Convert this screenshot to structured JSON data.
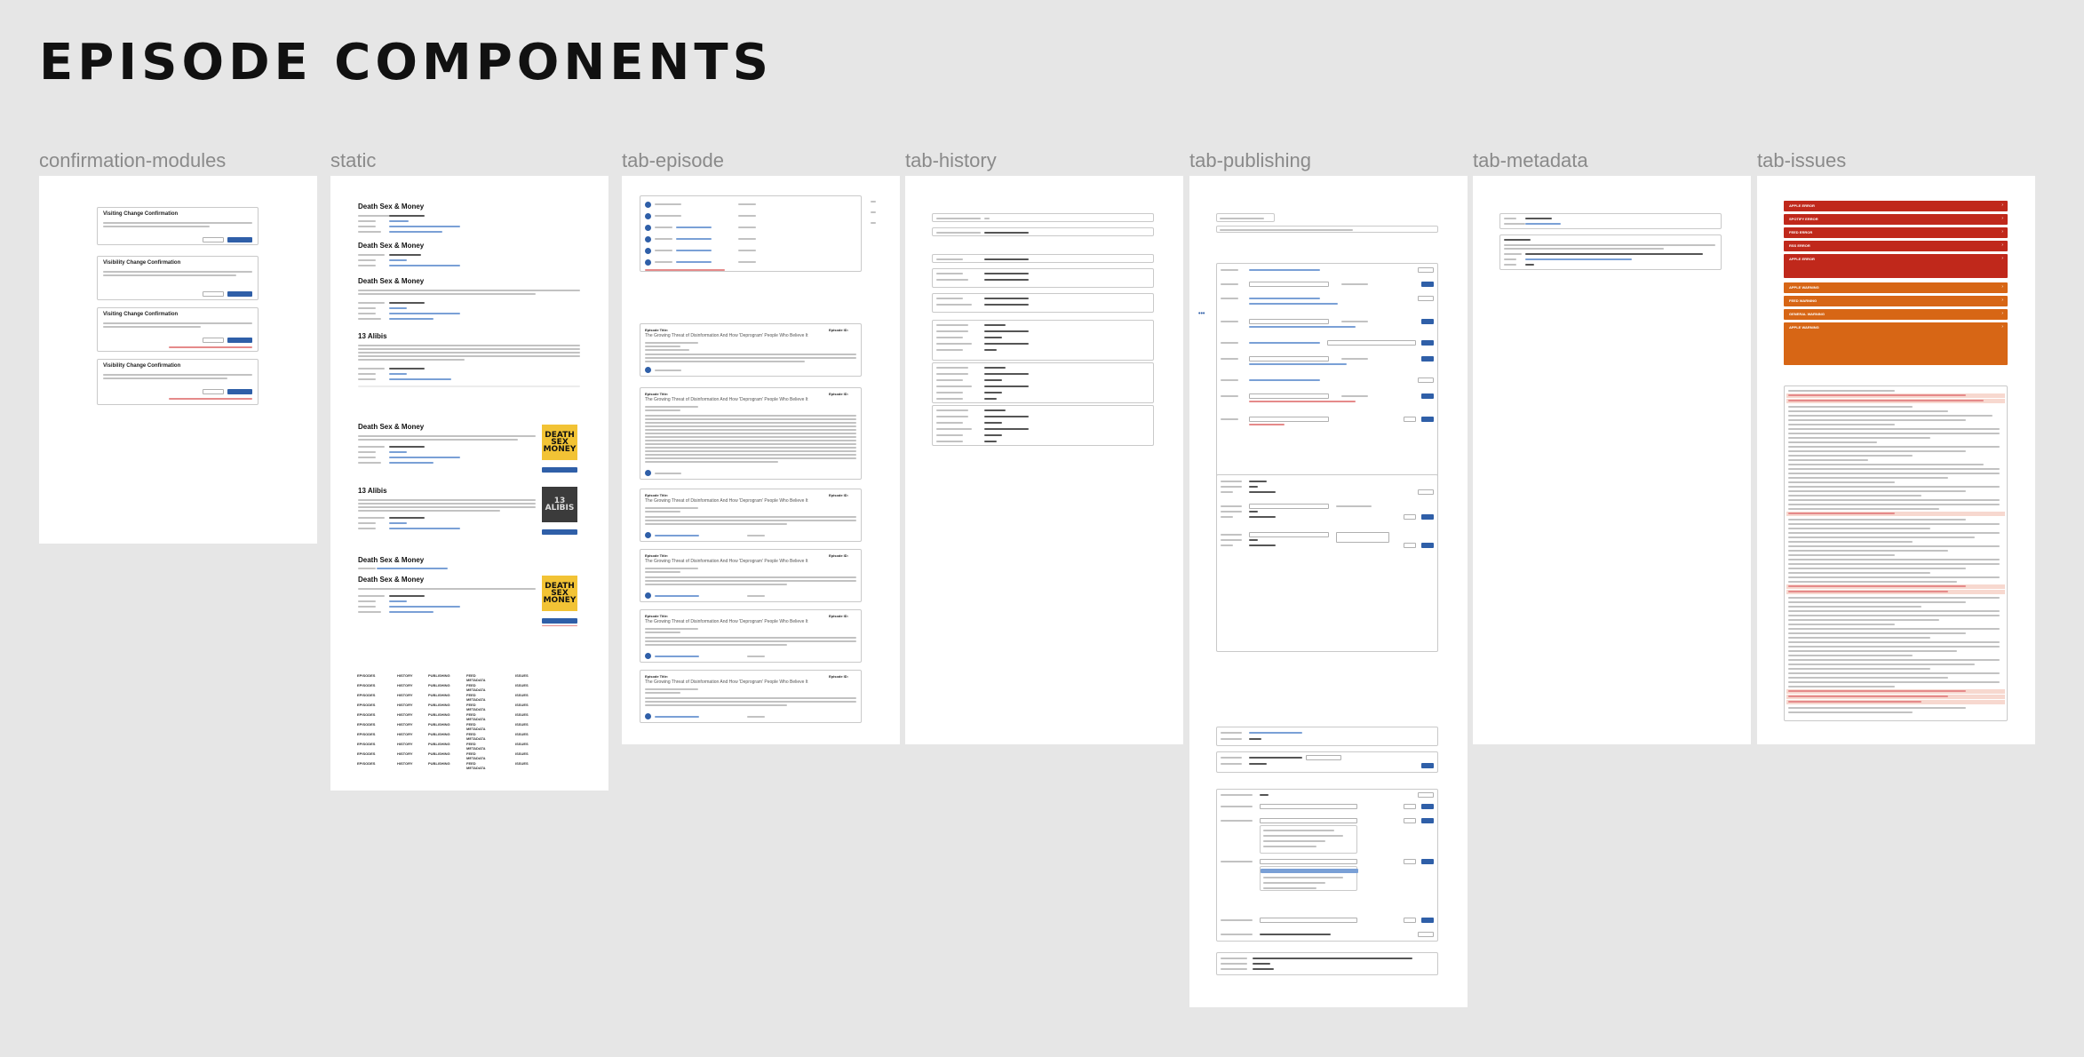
{
  "page": {
    "title": "EPISODE COMPONENTS"
  },
  "columns": [
    {
      "label": "confirmation-modules"
    },
    {
      "label": "static"
    },
    {
      "label": "tab-episode"
    },
    {
      "label": "tab-history"
    },
    {
      "label": "tab-publishing"
    },
    {
      "label": "tab-metadata"
    },
    {
      "label": "tab-issues"
    }
  ],
  "confirmation": {
    "modals": [
      {
        "title": "Visiting Change Confirmation",
        "cancel": "Cancel",
        "confirm": "Continue"
      },
      {
        "title": "Visibility Change Confirmation",
        "cancel": "Cancel",
        "confirm": "Continue"
      },
      {
        "title": "Visiting Change Confirmation",
        "cancel": "Cancel",
        "confirm": "Continue"
      },
      {
        "title": "Visibility Change Confirmation",
        "cancel": "Cancel",
        "confirm": "Continue"
      }
    ]
  },
  "static": {
    "shows": [
      {
        "title": "Death Sex & Money"
      },
      {
        "title": "Death Sex & Money"
      },
      {
        "title": "Death Sex & Money"
      },
      {
        "title": "13 Alibis"
      },
      {
        "title": "Death Sex & Money"
      },
      {
        "title": "13 Alibis"
      },
      {
        "title": "Death Sex & Money"
      },
      {
        "title": "Death Sex & Money"
      }
    ],
    "covers": [
      {
        "text": "DEATH SEX MONEY"
      },
      {
        "text": "13 ALIBIS"
      },
      {
        "text": "DEATH SEX MONEY"
      }
    ],
    "nav": [
      "EPISODES",
      "HISTORY",
      "PUBLISHING",
      "FEED METADATA",
      "ISSUES"
    ]
  },
  "episode": {
    "cards": [
      {
        "label": "Episode Title:",
        "title": "The Growing Threat of Disinformation And How 'Deprogram' People Who Believe It",
        "num": "Episode ID:"
      },
      {
        "label": "Episode Title:",
        "title": "The Growing Threat of Disinformation And How 'Deprogram' People Who Believe It",
        "num": "Episode ID:"
      },
      {
        "label": "Episode Title:",
        "title": "The Growing Threat of Disinformation And How 'Deprogram' People Who Believe It",
        "num": "Episode ID:"
      },
      {
        "label": "Episode Title:",
        "title": "The Growing Threat of Disinformation And How 'Deprogram' People Who Believe It",
        "num": "Episode ID:"
      },
      {
        "label": "Episode Title:",
        "title": "The Growing Threat of Disinformation And How 'Deprogram' People Who Believe It",
        "num": "Episode ID:"
      },
      {
        "label": "Episode Title:",
        "title": "The Growing Threat of Disinformation And How 'Deprogram' People Who Believe It",
        "num": "Episode ID:"
      }
    ]
  },
  "issues": {
    "banners": [
      {
        "tag": "APPLE ERROR",
        "color": "red"
      },
      {
        "tag": "SPOTIFY ERROR",
        "color": "red"
      },
      {
        "tag": "FEED ERROR",
        "color": "red"
      },
      {
        "tag": "RSS ERROR",
        "color": "red"
      },
      {
        "tag": "APPLE ERROR",
        "color": "red"
      },
      {
        "tag": "APPLE WARNING",
        "color": "orange"
      },
      {
        "tag": "FEED WARNING",
        "color": "orange"
      },
      {
        "tag": "GENERAL WARNING",
        "color": "orange"
      },
      {
        "tag": "APPLE WARNING",
        "color": "orange"
      }
    ]
  }
}
